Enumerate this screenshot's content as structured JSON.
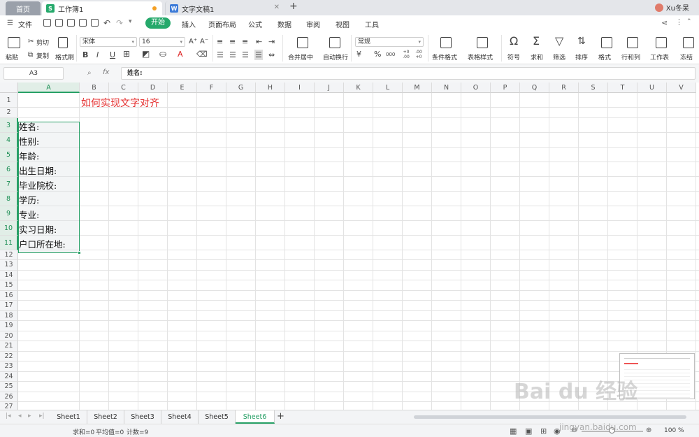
{
  "tabs": {
    "home": "首页",
    "workbook": "工作簿1",
    "document": "文字文稿1",
    "workbook_icon": "S",
    "document_icon": "W",
    "user": "Xu冬呆"
  },
  "menu": {
    "file": "文件",
    "items": [
      "开始",
      "插入",
      "页面布局",
      "公式",
      "数据",
      "审阅",
      "视图",
      "工具"
    ]
  },
  "ribbon": {
    "paste": "粘贴",
    "cut": "剪切",
    "copy": "复制",
    "format_painter": "格式刷",
    "font_name": "宋体",
    "font_size": "16",
    "bold": "B",
    "italic": "I",
    "underline": "U",
    "merge_center": "合并居中",
    "wrap_text": "自动换行",
    "number_format": "常规",
    "percent": "%",
    "thousand": "000",
    "dec_inc": "+0 .00",
    "dec_dec": ".00 +0",
    "conditional_format": "条件格式",
    "table_style": "表格样式",
    "symbol": "符号",
    "sum": "求和",
    "filter": "筛选",
    "sort": "排序",
    "format": "格式",
    "row_col": "行和列",
    "worksheet": "工作表",
    "freeze": "冻结"
  },
  "formula_bar": {
    "cell_ref": "A3",
    "fx": "fx",
    "content": "姓名:"
  },
  "columns": [
    "A",
    "B",
    "C",
    "D",
    "E",
    "F",
    "G",
    "H",
    "I",
    "J",
    "K",
    "L",
    "M",
    "N",
    "O",
    "P",
    "Q",
    "R",
    "S",
    "T",
    "U",
    "V"
  ],
  "rows": [
    "1",
    "2",
    "3",
    "4",
    "5",
    "6",
    "7",
    "8",
    "9",
    "10",
    "11",
    "12",
    "13",
    "14",
    "15",
    "16",
    "17",
    "18",
    "19",
    "20",
    "21",
    "22",
    "23",
    "24",
    "25",
    "26",
    "27"
  ],
  "title_cell": "如何实现文字对齐",
  "cells_A": [
    "姓名:",
    "性别:",
    "年龄:",
    "出生日期:",
    "毕业院校:",
    "学历:",
    "专业:",
    "实习日期:",
    "户口所在地:"
  ],
  "sheets": [
    "Sheet1",
    "Sheet2",
    "Sheet3",
    "Sheet4",
    "Sheet5",
    "Sheet6"
  ],
  "active_sheet": "Sheet6",
  "status": {
    "sum": "求和=0",
    "avg": "平均值=0",
    "count": "计数=9",
    "zoom": "100 %"
  },
  "watermark": {
    "logo": "Bai du 经验",
    "url": "jingyan.baidu.com"
  }
}
